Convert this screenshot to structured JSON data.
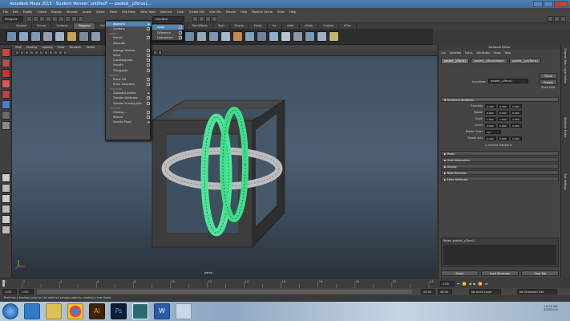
{
  "window": {
    "title": "Autodesk Maya 2015 - Student Version: untitled*   ---  pasted__pTorus1..."
  },
  "menubar": {
    "items": [
      "File",
      "Edit",
      "Modify",
      "Create",
      "Display",
      "Window",
      "Assets",
      "Select",
      "Mesh",
      "Edit Mesh",
      "Mesh Tools",
      "Normals",
      "Color",
      "Create UVs",
      "Edit UVs",
      "Muscle",
      "Help",
      "Pipeline Cache",
      "XGen",
      "Help"
    ]
  },
  "statusline": {
    "mode": "Polygons",
    "surface_dropdown": "<Surface"
  },
  "shelf": {
    "tabs": [
      "General",
      "Curves",
      "Surfaces",
      "Polygons",
      "Deform",
      "Animation",
      "Dynamics",
      "Rendering",
      "PaintEffects",
      "Toon",
      "Muscle",
      "Fluids",
      "Fur",
      "nHair",
      "nCloth",
      "Custom",
      "XGen"
    ],
    "active_tab": "Polygons"
  },
  "viewport": {
    "menu": [
      "View",
      "Shading",
      "Lighting",
      "Show",
      "Renderer",
      "Panels"
    ],
    "camera_label": "persp"
  },
  "mesh_menu": {
    "items": [
      {
        "label": "Booleans",
        "kind": "submenu",
        "highlight": true
      },
      {
        "label": "Combine",
        "kind": "option"
      },
      {
        "label": "PROXY",
        "kind": "section"
      },
      {
        "label": "Extract",
        "kind": "option"
      },
      {
        "label": "Separate",
        "kind": "item"
      },
      {
        "label": "",
        "kind": "spacer"
      },
      {
        "label": "Average Vertices",
        "kind": "option"
      },
      {
        "label": "Mirror",
        "kind": "option"
      },
      {
        "label": "Quadrangulate",
        "kind": "option"
      },
      {
        "label": "Smooth",
        "kind": "option"
      },
      {
        "label": "Triangulate",
        "kind": "option"
      },
      {
        "label": "MIRROR",
        "kind": "section"
      },
      {
        "label": "Mirror Cut",
        "kind": "option"
      },
      {
        "label": "Mirror Geometry",
        "kind": "option"
      },
      {
        "label": "TRANSFER",
        "kind": "section"
      },
      {
        "label": "Clipboard Actions",
        "kind": "submenu"
      },
      {
        "label": "Transfer Attributes",
        "kind": "option"
      },
      {
        "label": "Transfer Shading Sets",
        "kind": "option"
      },
      {
        "label": "OPTIMIZE",
        "kind": "section"
      },
      {
        "label": "Cleanup...",
        "kind": "option"
      },
      {
        "label": "Reduce",
        "kind": "option"
      },
      {
        "label": "Smooth Proxy",
        "kind": "submenu"
      }
    ],
    "booleans_submenu": [
      "Union",
      "Difference",
      "Intersection"
    ]
  },
  "attribute_editor": {
    "header": "Attribute Editor",
    "menu": [
      "List",
      "Selected",
      "Focus",
      "Attributes",
      "Show",
      "Help"
    ],
    "node_tabs": [
      "pasted__pTorus1",
      "pasted__pTorusShape1",
      "pasted__polyTorus1"
    ],
    "transform_label": "transform:",
    "transform_value": "pasted__pTorus1",
    "buttons": {
      "focus": "Focus",
      "presets": "Presets",
      "show": "Show",
      "hide": "Hide"
    },
    "sections_open": "Transform Attributes",
    "attributes": [
      {
        "label": "Translate",
        "values": [
          "0.000",
          "0.000",
          "0.000"
        ]
      },
      {
        "label": "Rotate",
        "values": [
          "0.000",
          "0.000",
          "0.000"
        ]
      },
      {
        "label": "Scale",
        "values": [
          "1.000",
          "1.000",
          "1.000"
        ]
      },
      {
        "label": "Shear",
        "values": [
          "0.000",
          "0.000",
          "0.000"
        ]
      },
      {
        "label": "Rotate Order",
        "values": [
          "xyz"
        ]
      },
      {
        "label": "Rotate Axis",
        "values": [
          "0.000",
          "0.000",
          "0.000"
        ]
      }
    ],
    "inherits_transform": "Inherits Transform",
    "collapsed_sections": [
      "Pivots",
      "Limit Information",
      "Display",
      "Node Behavior",
      "Extra Attributes"
    ],
    "notes_label": "Notes: pasted__pTorus1",
    "bottom_buttons": [
      "Select",
      "Load Attributes",
      "Copy Tab"
    ]
  },
  "side_tabs": [
    "Channel Box / Layer Editor",
    "Attribute Editor",
    "Tool Settings"
  ],
  "timeline": {
    "ticks": [
      "1",
      "2",
      "4",
      "6",
      "8",
      "10",
      "12",
      "14",
      "16",
      "18",
      "20",
      "22",
      "24"
    ],
    "current": "1.00"
  },
  "range": {
    "start": "1.00",
    "start2": "1.00",
    "end": "24.00",
    "end2": "48.00",
    "anim_layer": "No Anim Layer",
    "character": "No Character Set"
  },
  "helpline": "Performs a boolean union on the selected polygon objects, creating a new object",
  "taskbar": {
    "apps": [
      "start",
      "internet-explorer",
      "file-explorer",
      "chrome",
      "illustrator",
      "photoshop",
      "maya",
      "word",
      "paint"
    ],
    "time": "10:05 AM",
    "date": "3/25/2015"
  },
  "colors": {
    "selection_green": "#3fe08a",
    "menu_highlight": "#5285b5",
    "cube": "#3c3c3c"
  }
}
